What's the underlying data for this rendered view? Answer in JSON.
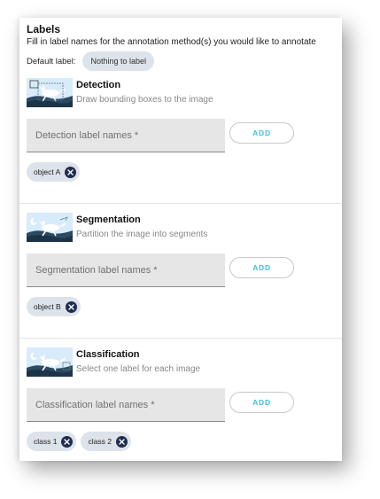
{
  "header": {
    "title": "Labels",
    "subtitle": "Fill in label names for the annotation method(s) you would like to annotate",
    "default_label_caption": "Default label:",
    "default_label_value": "Nothing to label"
  },
  "sections": [
    {
      "title": "Detection",
      "description": "Draw bounding boxes to the image",
      "placeholder": "Detection label names *",
      "add_label": "ADD",
      "chips": [
        "object A"
      ]
    },
    {
      "title": "Segmentation",
      "description": "Partition the image into segments",
      "placeholder": "Segmentation label names *",
      "add_label": "ADD",
      "chips": [
        "object B"
      ]
    },
    {
      "title": "Classification",
      "description": "Select one label for each image",
      "placeholder": "Classification label names *",
      "add_label": "ADD",
      "chips": [
        "class 1",
        "class 2"
      ]
    }
  ],
  "colors": {
    "accent": "#3ec2d6",
    "chip_bg": "#dde3ea",
    "chip_close": "#1f2c4f",
    "field_bg": "#e6e6e6"
  }
}
